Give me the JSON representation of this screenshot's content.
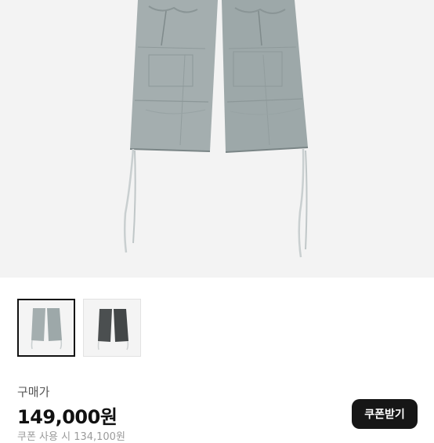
{
  "product": {
    "image_color": "#a4aeaf",
    "thumbnails": [
      {
        "name": "light-grey",
        "color": "#a4aeaf",
        "selected": true
      },
      {
        "name": "charcoal",
        "color": "#4b4f50",
        "selected": false
      }
    ]
  },
  "price": {
    "label": "구매가",
    "amount": "149,000원",
    "coupon_note": "쿠폰 사용 시 134,100원"
  },
  "coupon_button": {
    "label": "쿠폰받기"
  }
}
